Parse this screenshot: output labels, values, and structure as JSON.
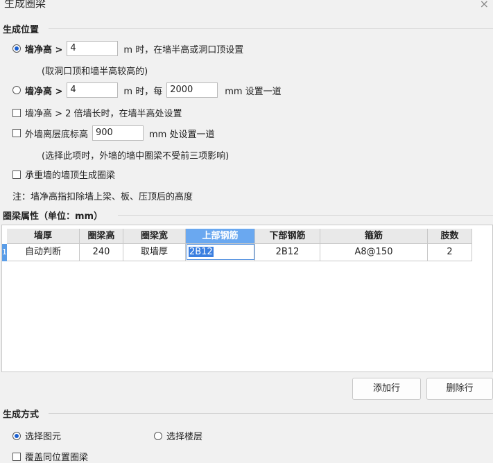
{
  "dialog": {
    "title": "生成圈梁",
    "close_glyph": "×"
  },
  "position_section": {
    "heading": "生成位置",
    "opt1": {
      "label": "墙净高 >",
      "value": "4",
      "suffix": "m 时，在墙半高或洞口顶设置",
      "selected": true
    },
    "opt1_note": "(取洞口顶和墙半高较高的)",
    "opt2": {
      "label": "墙净高 >",
      "value": "4",
      "mid": "m 时，每",
      "value2": "2000",
      "suffix": "mm 设置一道",
      "selected": false
    },
    "chk1": {
      "label": "墙净高 > 2 倍墙长时，在墙半高处设置",
      "checked": false
    },
    "chk2": {
      "label": "外墙离层底标高",
      "value": "900",
      "suffix": "mm 处设置一道",
      "checked": false
    },
    "chk2_note": "(选择此项时，外墙的墙中圈梁不受前三项影响)",
    "chk3": {
      "label": "承重墙的墙顶生成圈梁",
      "checked": false
    },
    "footnote": "注：墙净高指扣除墙上梁、板、压顶后的高度"
  },
  "props_section": {
    "heading": "圈梁属性（单位：mm）",
    "columns": [
      "墙厚",
      "圈梁高",
      "圈梁宽",
      "上部钢筋",
      "下部钢筋",
      "箍筋",
      "肢数"
    ],
    "rows": [
      {
        "index": "1",
        "cells": [
          "自动判断",
          "240",
          "取墙厚",
          "2B12",
          "2B12",
          "A8@150",
          "2"
        ]
      }
    ],
    "add_row_label": "添加行",
    "delete_row_label": "删除行"
  },
  "method_section": {
    "heading": "生成方式",
    "opt_select_element": {
      "label": "选择图元",
      "selected": true
    },
    "opt_select_floor": {
      "label": "选择楼层",
      "selected": false
    },
    "chk_cover": {
      "label": "覆盖同位置圈梁",
      "checked": false
    }
  },
  "colors": {
    "accent": "#1a5fd0",
    "header_selected": "#6aa8f0",
    "row_header": "#5a9de8"
  }
}
